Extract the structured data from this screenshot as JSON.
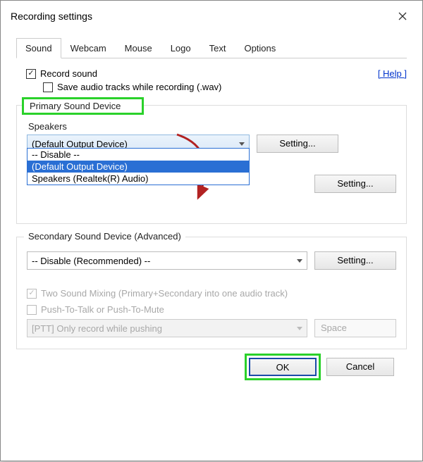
{
  "window": {
    "title": "Recording settings"
  },
  "tabs": [
    "Sound",
    "Webcam",
    "Mouse",
    "Logo",
    "Text",
    "Options"
  ],
  "active_tab": 0,
  "checkboxes": {
    "record_sound": "Record sound",
    "save_audio_tracks": "Save audio tracks while recording (.wav)"
  },
  "help": "[ Help ]",
  "primary": {
    "legend": "Primary Sound Device",
    "label_speakers": "Speakers",
    "selected": "(Default Output Device)",
    "options": [
      "-- Disable --",
      "(Default Output Device)",
      "Speakers (Realtek(R) Audio)"
    ],
    "btn_setting": "Setting..."
  },
  "secondary": {
    "legend": "Secondary Sound Device (Advanced)",
    "selected": "-- Disable (Recommended) --",
    "btn_setting": "Setting...",
    "two_mix": "Two Sound Mixing (Primary+Secondary into one audio track)",
    "ptt": "Push-To-Talk or Push-To-Mute",
    "ptt_mode": "[PTT] Only record while pushing",
    "ptt_key": "Space"
  },
  "footer": {
    "ok": "OK",
    "cancel": "Cancel"
  }
}
